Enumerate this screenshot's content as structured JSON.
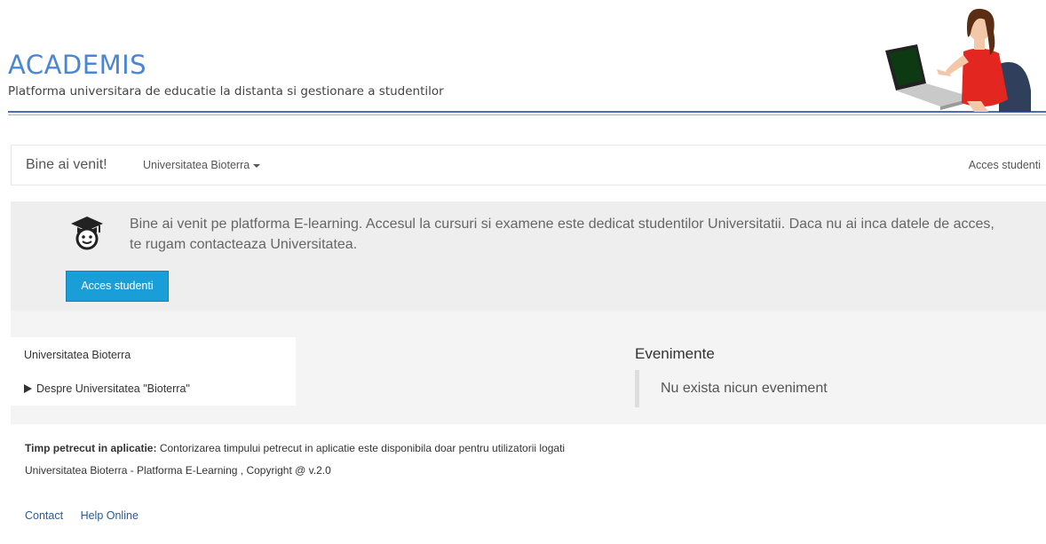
{
  "header": {
    "title": "ACADEMIS",
    "subtitle": "Platforma universitara de educatie la distanta si gestionare a studentilor"
  },
  "navbar": {
    "brand": "Bine ai venit!",
    "dropdown_label": "Universitatea Bioterra",
    "right_link": "Acces studenti"
  },
  "welcome": {
    "icon": "graduate-icon",
    "message": "Bine ai venit pe platforma E-learning. Accesul la cursuri si examene este dedicat studentilor Universitatii. Daca nu ai inca datele de acces, te rugam contacteaza Universitatea.",
    "button_label": "Acces studenti",
    "button_color": "#1a9ed8"
  },
  "sidebar_block": {
    "title": "Universitatea Bioterra",
    "link": "Despre Universitatea \"Bioterra\""
  },
  "events": {
    "title": "Evenimente",
    "empty_message": "Nu exista nicun eveniment"
  },
  "footer": {
    "time_label": "Timp petrecut in aplicatie:",
    "time_text": " Contorizarea timpului petrecut in aplicatie este disponibila doar pentru utilizatorii logati",
    "copyright": "Universitatea Bioterra - Platforma E-Learning , Copyright @ v.2.0",
    "links": [
      "Contact",
      "Help Online"
    ]
  },
  "colors": {
    "brand": "#4a86d4",
    "link": "#2a5b94"
  }
}
